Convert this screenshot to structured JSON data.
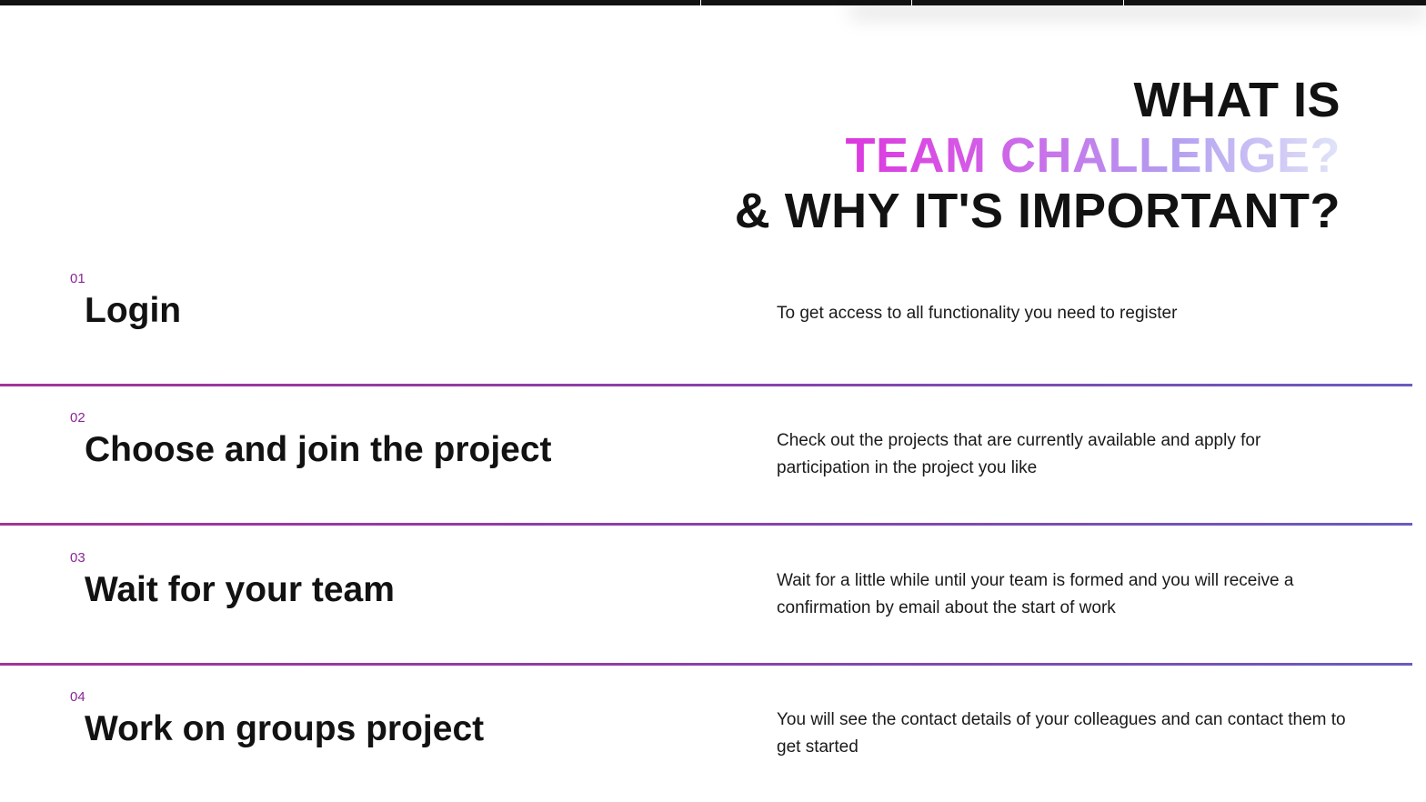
{
  "heading": {
    "line1": "WHAT IS",
    "line2": "TEAM CHALLENGE?",
    "line3": "& WHY IT'S IMPORTANT?"
  },
  "steps": [
    {
      "number": "01",
      "title": "Login",
      "description": "To get access to all functionality you need to register"
    },
    {
      "number": "02",
      "title": "Choose and join the project",
      "description": "Check out the projects that are currently available and apply for participation in the project you like"
    },
    {
      "number": "03",
      "title": "Wait for your team",
      "description": "Wait for a little while until your team is formed and you will receive a confirmation by email about the start of work"
    },
    {
      "number": "04",
      "title": "Work on groups project",
      "description": "You will see the contact details of your colleagues and can contact them to get started"
    }
  ],
  "colors": {
    "step_number": "#8a2796",
    "divider_start": "#a2349a",
    "divider_end": "#6a5bbe",
    "heading_gradient_start": "#e31ad8",
    "heading_gradient_end": "#e0e4f8"
  }
}
